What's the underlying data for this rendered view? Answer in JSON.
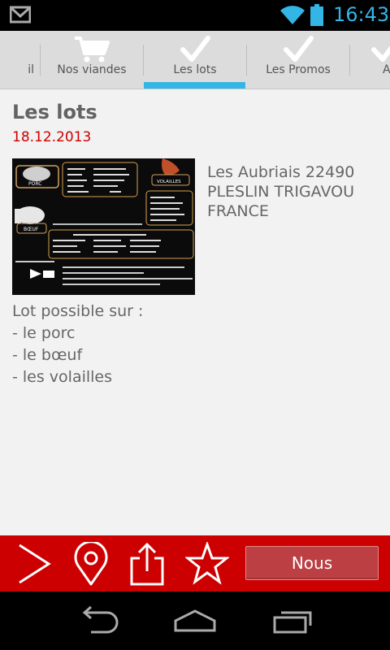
{
  "status_bar": {
    "time": "16:43",
    "icons": [
      "gmail-icon",
      "wifi-icon",
      "battery-icon"
    ],
    "time_color": "#33b5e5"
  },
  "tabs": [
    {
      "label": "il",
      "icon": "partial"
    },
    {
      "label": "Nos viandes",
      "icon": "cart-icon"
    },
    {
      "label": "Les lots",
      "icon": "check-icon",
      "selected": true
    },
    {
      "label": "Les Promos",
      "icon": "check-icon"
    },
    {
      "label": "A",
      "icon": "partial"
    }
  ],
  "page": {
    "title": "Les lots",
    "date": "18.12.2013",
    "address_lines": [
      "Les Aubriais 22490",
      "PLESLIN TRIGAVOU",
      "FRANCE"
    ],
    "description_lines": [
      "Lot possible sur :",
      "- le porc",
      "- le bœuf",
      "- les volailles"
    ],
    "image_labels": {
      "porc": "PORC",
      "boeuf": "BŒUF",
      "volailles": "VOLAILLES"
    }
  },
  "action_bar": {
    "icons": [
      "next-icon",
      "location-pin-icon",
      "share-icon",
      "star-icon"
    ],
    "button_label": "Nous"
  },
  "nav_bar": {
    "icons": [
      "back-icon",
      "home-icon",
      "recent-apps-icon"
    ]
  },
  "colors": {
    "accent_red": "#cc0000",
    "accent_blue": "#33b5e5",
    "button_red": "#bc3f43"
  }
}
